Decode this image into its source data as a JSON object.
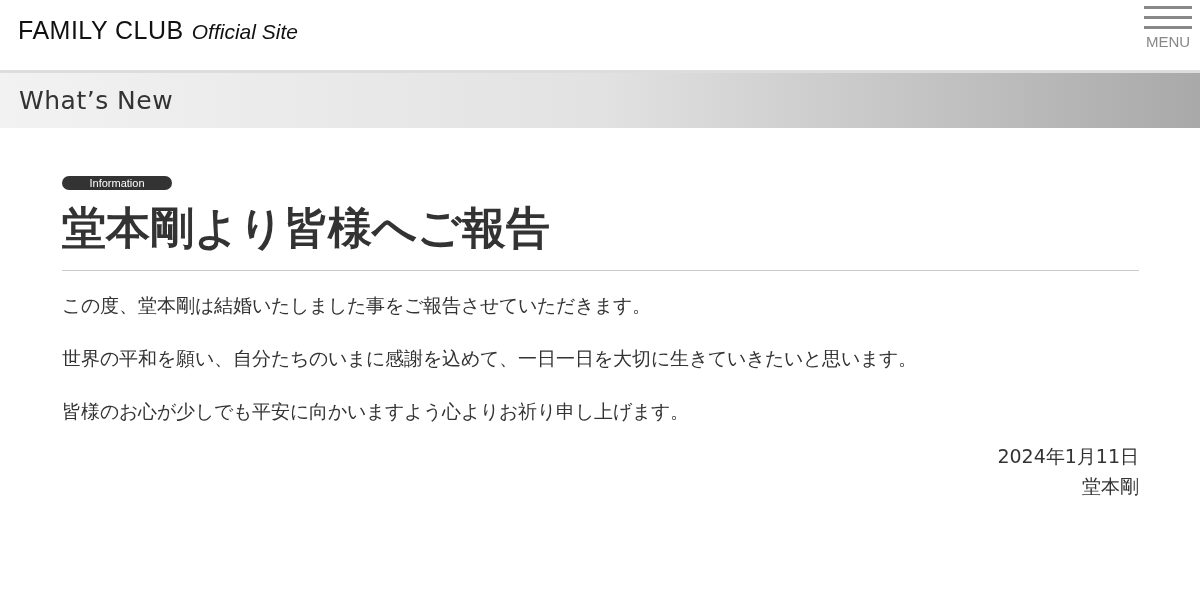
{
  "header": {
    "logo": "FAMILY CLUB",
    "logo_sub": "Official Site",
    "menu_label": "MENU"
  },
  "section_title": "What’s New",
  "article": {
    "category": "Information",
    "title": "堂本剛より皆様へご報告",
    "paragraphs": [
      "この度、堂本剛は結婚いたしました事をご報告させていただきます。",
      "世界の平和を願い、自分たちのいまに感謝を込めて、一日一日を大切に生きていきたいと思います。",
      "皆様のお心が少しでも平安に向かいますよう心よりお祈り申し上げます。"
    ],
    "date": "2024年1月11日",
    "signature": "堂本剛"
  }
}
